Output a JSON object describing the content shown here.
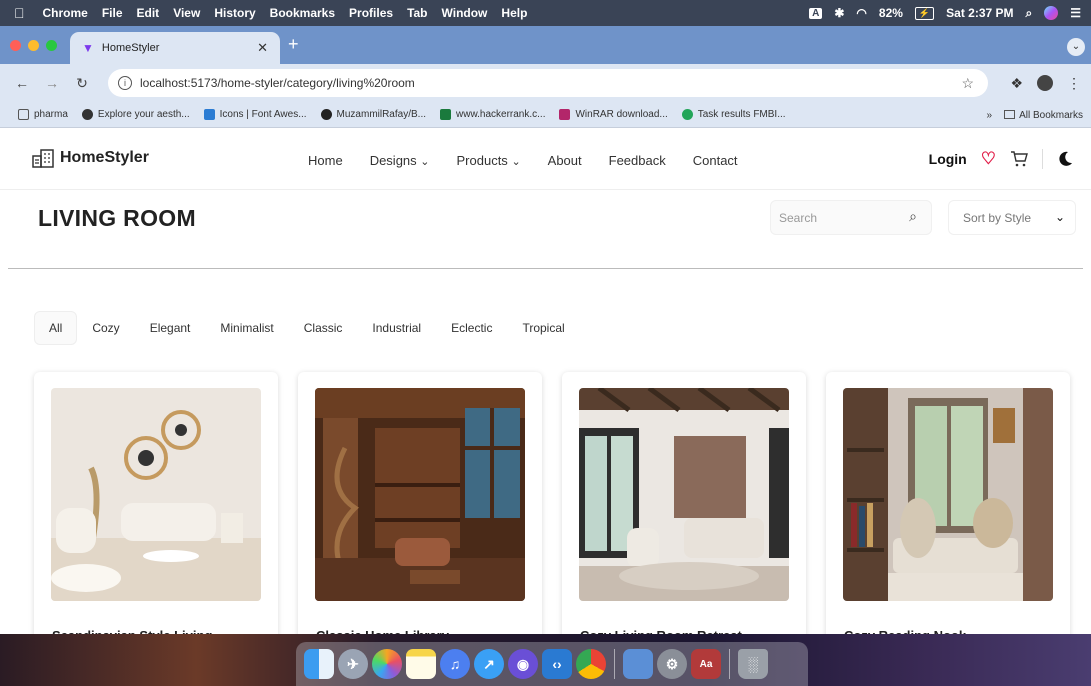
{
  "menubar": {
    "app": "Chrome",
    "items": [
      "File",
      "Edit",
      "View",
      "History",
      "Bookmarks",
      "Profiles",
      "Tab",
      "Window",
      "Help"
    ],
    "battery": "82%",
    "clock": "Sat 2:37 PM"
  },
  "browser": {
    "tab_title": "HomeStyler",
    "url": "localhost:5173/home-styler/category/living%20room",
    "bookmarks": [
      {
        "label": "pharma",
        "icon": "folder-icon",
        "color": "#555555"
      },
      {
        "label": "Explore your aesth...",
        "icon": "chrome-web-icon",
        "color": "#333333"
      },
      {
        "label": "Icons | Font Awes...",
        "icon": "font-awesome-icon",
        "color": "#2b7cd3"
      },
      {
        "label": "MuzammilRafay/B...",
        "icon": "github-icon",
        "color": "#222222"
      },
      {
        "label": "www.hackerrank.c...",
        "icon": "hackerrank-icon",
        "color": "#1a7a3d"
      },
      {
        "label": "WinRAR download...",
        "icon": "winrar-icon",
        "color": "#b3266a"
      },
      {
        "label": "Task results FMBI...",
        "icon": "task-icon",
        "color": "#22a559"
      }
    ],
    "all_bookmarks": "All Bookmarks"
  },
  "site": {
    "logo": "HomeStyler",
    "nav": [
      "Home",
      "Designs",
      "Products",
      "About",
      "Feedback",
      "Contact"
    ],
    "login": "Login",
    "accent": "#e11d48"
  },
  "category": {
    "title": "LIVING ROOM",
    "search_placeholder": "Search",
    "sort_label": "Sort by Style",
    "filters": [
      "All",
      "Cozy",
      "Elegant",
      "Minimalist",
      "Classic",
      "Industrial",
      "Eclectic",
      "Tropical"
    ],
    "active_filter": "All"
  },
  "cards": [
    {
      "title": "Scandinavian Style Living"
    },
    {
      "title": "Classic Home Library"
    },
    {
      "title": "Cozy Living Room Retreat"
    },
    {
      "title": "Cozy Reading Nook"
    }
  ]
}
